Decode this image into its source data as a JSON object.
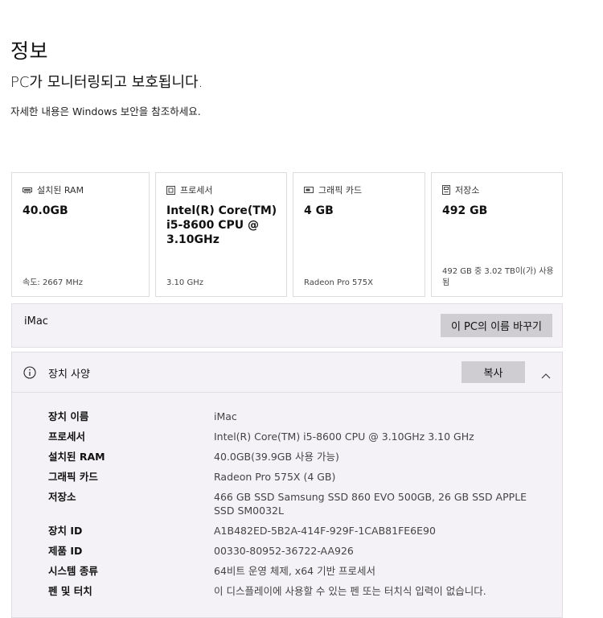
{
  "page": {
    "title": "정보",
    "subtitle": "PC가 모니터링되고 보호됩니다.",
    "description": "자세한 내용은 Windows 보안을 참조하세요."
  },
  "cards": [
    {
      "label": "설치된 RAM",
      "icon": "ram-icon",
      "value": "40.0GB",
      "footer": "속도: 2667 MHz"
    },
    {
      "label": "프로세서",
      "icon": "processor-icon",
      "value": "Intel(R) Core(TM) i5-8600 CPU @ 3.10GHz",
      "footer": "3.10 GHz"
    },
    {
      "label": "그래픽 카드",
      "icon": "graphics-card-icon",
      "value": "4 GB",
      "footer": "Radeon Pro 575X"
    },
    {
      "label": "저장소",
      "icon": "storage-icon",
      "value": "492 GB",
      "footer": "492 GB 중 3.02 TB이(가) 사용됨"
    }
  ],
  "device": {
    "name": "iMac",
    "rename_label": "이 PC의 이름 바꾸기"
  },
  "specs": {
    "title": "장치 사양",
    "copy_label": "복사",
    "rows": [
      {
        "label": "장치 이름",
        "value": "iMac"
      },
      {
        "label": "프로세서",
        "value": "Intel(R) Core(TM) i5-8600 CPU @ 3.10GHz   3.10 GHz"
      },
      {
        "label": "설치된 RAM",
        "value": "40.0GB(39.9GB 사용 가능)"
      },
      {
        "label": "그래픽 카드",
        "value": "Radeon Pro 575X (4 GB)"
      },
      {
        "label": "저장소",
        "value": "466 GB SSD Samsung SSD 860 EVO 500GB, 26 GB SSD APPLE SSD SM0032L"
      },
      {
        "label": "장치 ID",
        "value": "A1B482ED-5B2A-414F-929F-1CAB81FE6E90"
      },
      {
        "label": "제품 ID",
        "value": "00330-80952-36722-AA926"
      },
      {
        "label": "시스템 종류",
        "value": "64비트 운영 체제, x64 기반 프로세서"
      },
      {
        "label": "펜 및 터치",
        "value": "이 디스플레이에 사용할 수 있는 펜 또는 터치식 입력이 없습니다."
      }
    ]
  }
}
